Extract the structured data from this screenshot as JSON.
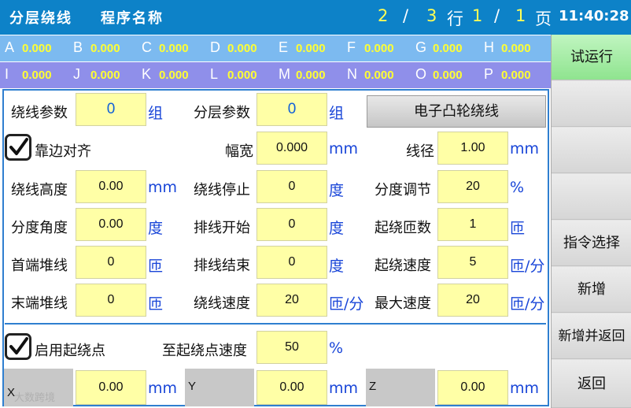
{
  "header": {
    "title": "分层绕线",
    "program_name_label": "程序名称",
    "row_current": "2",
    "separator": "/",
    "row_total": "3",
    "row_unit": "行",
    "page_current": "1",
    "page_total": "1",
    "page_unit": "页",
    "clock": "11:40:28"
  },
  "axes_row1": [
    {
      "label": "A",
      "value": "0.000"
    },
    {
      "label": "B",
      "value": "0.000"
    },
    {
      "label": "C",
      "value": "0.000"
    },
    {
      "label": "D",
      "value": "0.000"
    },
    {
      "label": "E",
      "value": "0.000"
    },
    {
      "label": "F",
      "value": "0.000"
    },
    {
      "label": "G",
      "value": "0.000"
    },
    {
      "label": "H",
      "value": "0.000"
    }
  ],
  "axes_row2": [
    {
      "label": "I",
      "value": "0.000"
    },
    {
      "label": "J",
      "value": "0.000"
    },
    {
      "label": "K",
      "value": "0.000"
    },
    {
      "label": "L",
      "value": "0.000"
    },
    {
      "label": "M",
      "value": "0.000"
    },
    {
      "label": "N",
      "value": "0.000"
    },
    {
      "label": "O",
      "value": "0.000"
    },
    {
      "label": "P",
      "value": "0.000"
    }
  ],
  "sidebar": {
    "test_run": "试运行",
    "command_select": "指令选择",
    "add": "新增",
    "add_and_return": "新增并返回",
    "back": "返回"
  },
  "form": {
    "winding_params": {
      "label": "绕线参数",
      "value": "0",
      "unit": "组"
    },
    "layer_params": {
      "label": "分层参数",
      "value": "0",
      "unit": "组"
    },
    "cam_button": "电子凸轮绕线",
    "edge_align": {
      "label": "靠边对齐",
      "checked": true
    },
    "width": {
      "label": "幅宽",
      "value": "0.000",
      "unit": "mm"
    },
    "wire_dia": {
      "label": "线径",
      "value": "1.00",
      "unit": "mm"
    },
    "winding_height": {
      "label": "绕线高度",
      "value": "0.00",
      "unit": "mm"
    },
    "winding_stop": {
      "label": "绕线停止",
      "value": "0",
      "unit": "度"
    },
    "index_adjust": {
      "label": "分度调节",
      "value": "20",
      "unit": "%"
    },
    "index_angle": {
      "label": "分度角度",
      "value": "0.00",
      "unit": "度"
    },
    "layout_start": {
      "label": "排线开始",
      "value": "0",
      "unit": "度"
    },
    "start_turns": {
      "label": "起绕匝数",
      "value": "1",
      "unit": "匝"
    },
    "head_stack": {
      "label": "首端堆线",
      "value": "0",
      "unit": "匝"
    },
    "layout_end": {
      "label": "排线结束",
      "value": "0",
      "unit": "度"
    },
    "start_speed": {
      "label": "起绕速度",
      "value": "5",
      "unit": "匝/分"
    },
    "tail_stack": {
      "label": "末端堆线",
      "value": "0",
      "unit": "匝"
    },
    "winding_speed": {
      "label": "绕线速度",
      "value": "20",
      "unit": "匝/分"
    },
    "max_speed": {
      "label": "最大速度",
      "value": "20",
      "unit": "匝/分"
    },
    "enable_start_point": {
      "label": "启用起绕点",
      "checked": true
    },
    "to_start_speed": {
      "label": "至起绕点速度",
      "value": "50",
      "unit": "%"
    },
    "x": {
      "label": "X",
      "value": "0.00",
      "unit": "mm"
    },
    "y": {
      "label": "Y",
      "value": "0.00",
      "unit": "mm"
    },
    "z": {
      "label": "Z",
      "value": "0.00",
      "unit": "mm"
    }
  },
  "watermark": "大数跨境",
  "colors": {
    "title_bar": "#0d82c8",
    "axis_row1": "#7cbaf0",
    "axis_row2": "#8f8fea",
    "value_yellow": "#ffff33",
    "field_bg": "#ffffa6",
    "unit_blue": "#1845d8",
    "test_run_green": "#8fe48f"
  }
}
